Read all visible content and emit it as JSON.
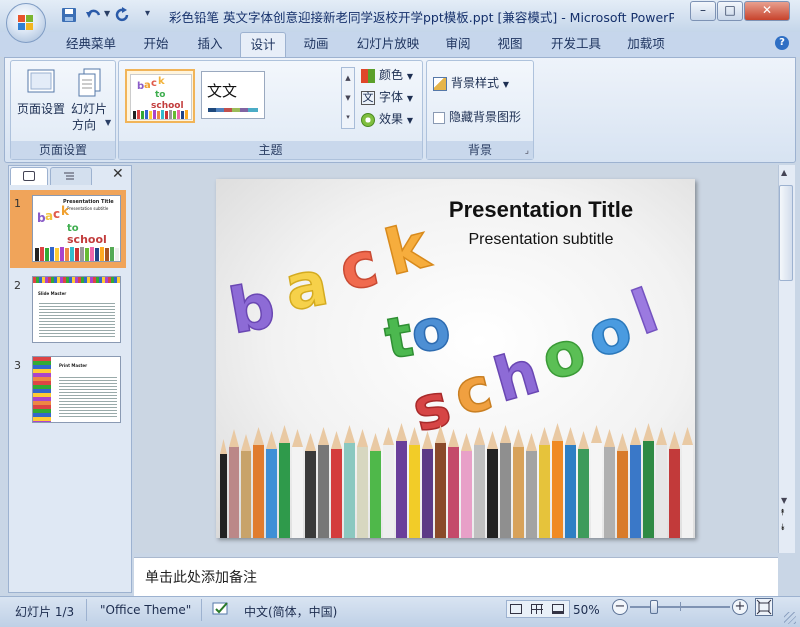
{
  "window": {
    "title": "彩色铅笔 英文字体创意迎接新老同学返校开学ppt模板.ppt [兼容模式] - Microsoft PowerPoint",
    "minimize": "–",
    "maximize": "□",
    "close": "✕"
  },
  "tabs": [
    "经典菜单",
    "开始",
    "插入",
    "设计",
    "动画",
    "幻灯片放映",
    "审阅",
    "视图",
    "开发工具",
    "加载项"
  ],
  "active_tab": "设计",
  "ribbon": {
    "page_setup_group": {
      "label": "页面设置",
      "page_setup_button": "页面设置",
      "orientation_button_line1": "幻灯片",
      "orientation_button_line2": "方向"
    },
    "theme_group": {
      "label": "主题",
      "theme2_text": "文文",
      "colors": "颜色",
      "fonts": "字体",
      "effects": "效果"
    },
    "background_group": {
      "label": "背景",
      "background_styles": "背景样式",
      "hide_background": "隐藏背景图形"
    }
  },
  "slides_panel": {
    "tab_slides_icon": "slides-icon",
    "tab_outline_icon": "outline-icon",
    "close_icon": "close-icon",
    "slides": [
      {
        "number": "1",
        "title": "Presentation Title",
        "subtitle": "Presentation subtitle",
        "selected": true
      },
      {
        "number": "2",
        "title": "Slide Master",
        "selected": false
      },
      {
        "number": "3",
        "title": "Print Master",
        "selected": false
      }
    ]
  },
  "slide": {
    "title": "Presentation Title",
    "subtitle": "Presentation subtitle",
    "art_line1": "back",
    "art_line2": "to",
    "art_line3": "school"
  },
  "notes": {
    "placeholder": "单击此处添加备注"
  },
  "status": {
    "slide_counter": "幻灯片 1/3",
    "theme": "\"Office Theme\"",
    "language": "中文(简体，中国)",
    "zoom": "50%"
  },
  "colors": {
    "selected_slide": "#f0a45a",
    "accent": "#2f6fc4"
  }
}
